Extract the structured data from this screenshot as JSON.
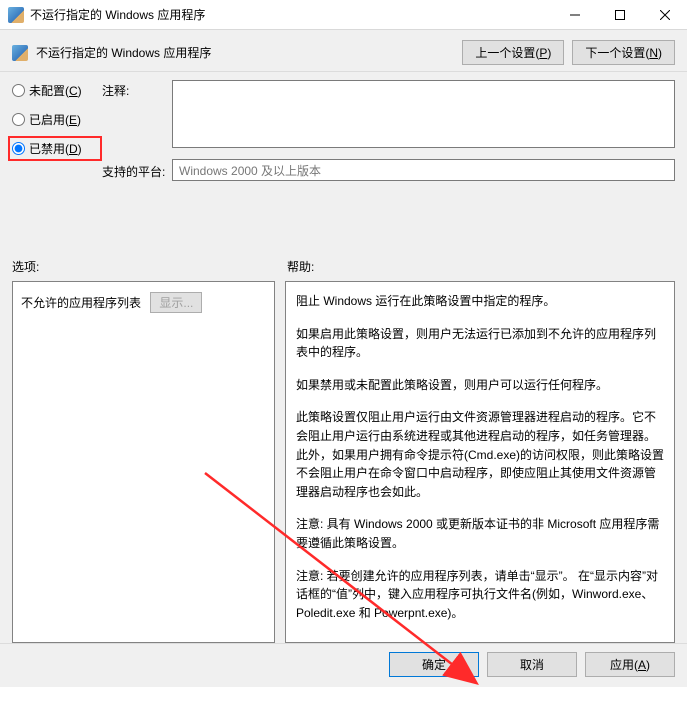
{
  "window": {
    "title": "不运行指定的 Windows 应用程序"
  },
  "toolbar": {
    "caption": "不运行指定的 Windows 应用程序",
    "prev_btn": "上一个设置(P)",
    "next_btn": "下一个设置(N)"
  },
  "radios": {
    "not_configured": "未配置(C)",
    "enabled": "已启用(E)",
    "disabled": "已禁用(D)",
    "selected": "disabled"
  },
  "labels": {
    "comment": "注释:",
    "platform": "支持的平台:",
    "options": "选项:",
    "help": "帮助:"
  },
  "fields": {
    "comment_value": "",
    "platform_value": "Windows 2000 及以上版本"
  },
  "options_panel": {
    "list_label": "不允许的应用程序列表",
    "show_btn": "显示..."
  },
  "help_panel": {
    "p1": "阻止 Windows 运行在此策略设置中指定的程序。",
    "p2": "如果启用此策略设置，则用户无法运行已添加到不允许的应用程序列表中的程序。",
    "p3": "如果禁用或未配置此策略设置，则用户可以运行任何程序。",
    "p4": "此策略设置仅阻止用户运行由文件资源管理器进程启动的程序。它不会阻止用户运行由系统进程或其他进程启动的程序，如任务管理器。 此外，如果用户拥有命令提示符(Cmd.exe)的访问权限，则此策略设置不会阻止用户在命令窗口中启动程序，即使应阻止其使用文件资源管理器启动程序也会如此。",
    "p5": "注意: 具有 Windows 2000 或更新版本证书的非 Microsoft 应用程序需要遵循此策略设置。",
    "p6": "注意: 若要创建允许的应用程序列表，请单击“显示”。 在“显示内容”对话框的“值”列中，键入应用程序可执行文件名(例如，Winword.exe、Poledit.exe 和 Powerpnt.exe)。"
  },
  "footer": {
    "ok": "确定",
    "cancel": "取消",
    "apply": "应用(A)"
  }
}
